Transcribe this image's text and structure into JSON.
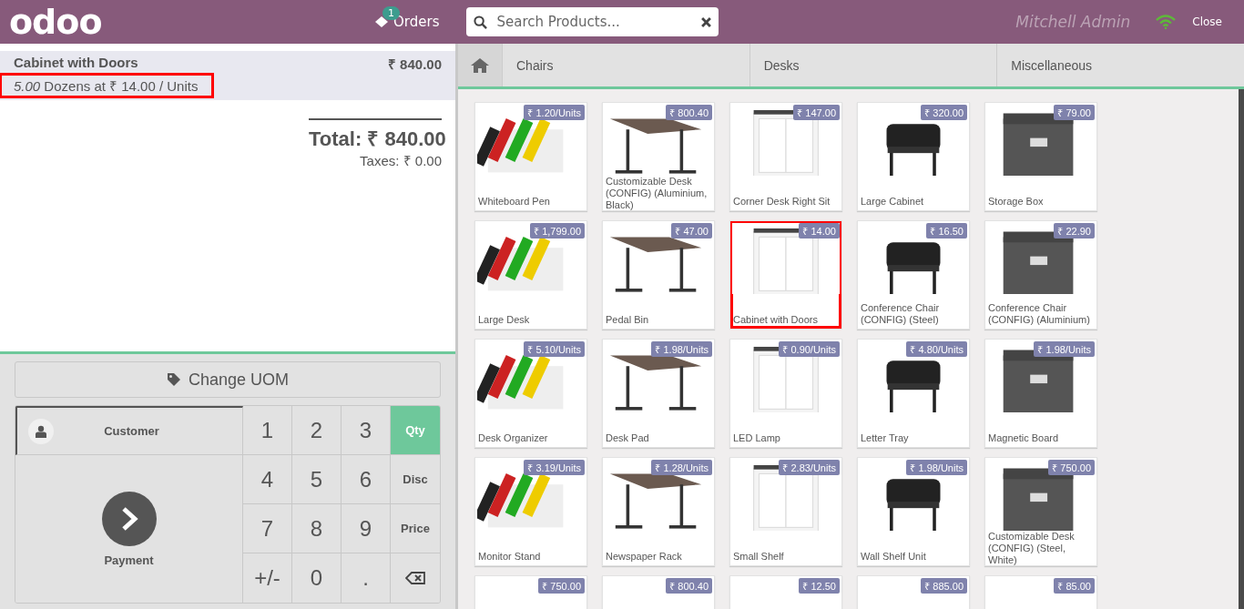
{
  "header": {
    "logo": "odoo",
    "orders": {
      "label": "Orders",
      "count": "1"
    },
    "search": {
      "placeholder": "Search Products..."
    },
    "user": "Mitchell Admin",
    "close": "Close"
  },
  "order": {
    "lines": [
      {
        "name": "Cabinet with Doors",
        "price": "₹ 840.00",
        "detail": "*5.00* Dozens at ₹ 14.00 / Units",
        "selected": true,
        "highlighted": true
      }
    ],
    "total": "Total: ₹ 840.00",
    "taxes": "Taxes: ₹ 0.00"
  },
  "actions": [
    {
      "label": "Change UOM"
    }
  ],
  "pad": {
    "customer": "Customer",
    "payment": "Payment",
    "keys": [
      {
        "kind": "digit",
        "label": "1"
      },
      {
        "kind": "digit",
        "label": "2"
      },
      {
        "kind": "digit",
        "label": "3"
      },
      {
        "kind": "mode",
        "label": "Qty",
        "selected": true
      },
      {
        "kind": "digit",
        "label": "4"
      },
      {
        "kind": "digit",
        "label": "5"
      },
      {
        "kind": "digit",
        "label": "6"
      },
      {
        "kind": "mode",
        "label": "Disc",
        "selected": false
      },
      {
        "kind": "digit",
        "label": "7"
      },
      {
        "kind": "digit",
        "label": "8"
      },
      {
        "kind": "digit",
        "label": "9"
      },
      {
        "kind": "mode",
        "label": "Price",
        "selected": false
      },
      {
        "kind": "digit",
        "label": "+/-"
      },
      {
        "kind": "digit",
        "label": "0"
      },
      {
        "kind": "digit",
        "label": "."
      },
      {
        "kind": "backspace"
      }
    ]
  },
  "categories": [
    {
      "label": "Chairs"
    },
    {
      "label": "Desks"
    },
    {
      "label": "Miscellaneous"
    }
  ],
  "products": [
    {
      "name": "Whiteboard Pen",
      "price": "₹ 1.20/Units",
      "highlighted": false
    },
    {
      "name": "Customizable Desk (CONFIG) (Aluminium, Black)",
      "price": "₹ 800.40",
      "highlighted": false
    },
    {
      "name": "Corner Desk Right Sit",
      "price": "₹ 147.00",
      "highlighted": false
    },
    {
      "name": "Large Cabinet",
      "price": "₹ 320.00",
      "highlighted": false
    },
    {
      "name": "Storage Box",
      "price": "₹ 79.00",
      "highlighted": false
    },
    {
      "name": "Large Desk",
      "price": "₹ 1,799.00",
      "highlighted": false
    },
    {
      "name": "Pedal Bin",
      "price": "₹ 47.00",
      "highlighted": false
    },
    {
      "name": "Cabinet with Doors",
      "price": "₹ 14.00",
      "highlighted": true
    },
    {
      "name": "Conference Chair (CONFIG) (Steel)",
      "price": "₹ 16.50",
      "highlighted": false
    },
    {
      "name": "Conference Chair (CONFIG) (Aluminium)",
      "price": "₹ 22.90",
      "highlighted": false
    },
    {
      "name": "Desk Organizer",
      "price": "₹ 5.10/Units",
      "highlighted": false
    },
    {
      "name": "Desk Pad",
      "price": "₹ 1.98/Units",
      "highlighted": false
    },
    {
      "name": "LED Lamp",
      "price": "₹ 0.90/Units",
      "highlighted": false
    },
    {
      "name": "Letter Tray",
      "price": "₹ 4.80/Units",
      "highlighted": false
    },
    {
      "name": "Magnetic Board",
      "price": "₹ 1.98/Units",
      "highlighted": false
    },
    {
      "name": "Monitor Stand",
      "price": "₹ 3.19/Units",
      "highlighted": false
    },
    {
      "name": "Newspaper Rack",
      "price": "₹ 1.28/Units",
      "highlighted": false
    },
    {
      "name": "Small Shelf",
      "price": "₹ 2.83/Units",
      "highlighted": false
    },
    {
      "name": "Wall Shelf Unit",
      "price": "₹ 1.98/Units",
      "highlighted": false
    },
    {
      "name": "Customizable Desk (CONFIG) (Steel, White)",
      "price": "₹ 750.00",
      "highlighted": false
    },
    {
      "price": "₹ 750.00",
      "highlighted": false
    },
    {
      "price": "₹ 800.40",
      "highlighted": false
    },
    {
      "price": "₹ 12.50",
      "highlighted": false
    },
    {
      "price": "₹ 885.00",
      "highlighted": false
    },
    {
      "price": "₹ 85.00",
      "highlighted": false
    }
  ]
}
